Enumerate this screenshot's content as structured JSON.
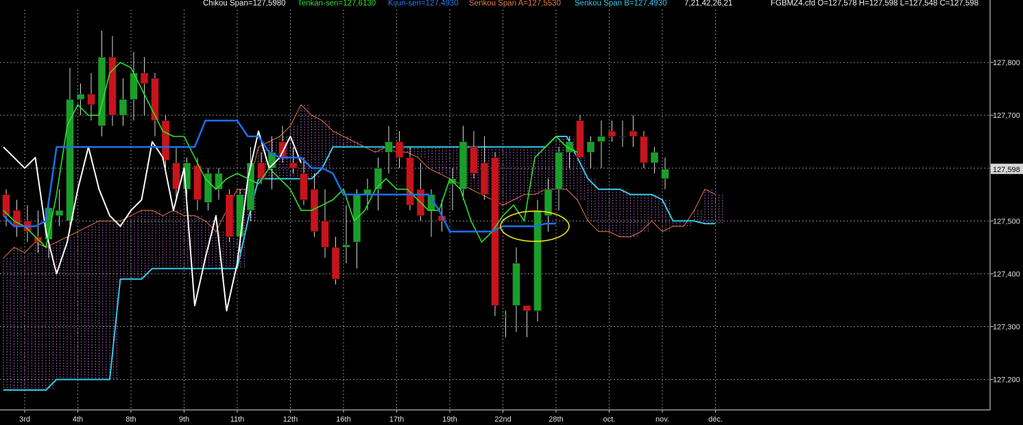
{
  "header": {
    "chikou": "Chikou Span=127,5980",
    "tenkan": "Tenkan-sen=127,6130",
    "kijun": "Kijun-sen=127,4930",
    "senkou_a": "Senkou Span A=127,5530",
    "senkou_b": "Senkou Span B=127,4930",
    "params": "7,21,42,26,21",
    "ohlc": "FGBMZ4.cfd O=127,578 H=127,598 L=127,548 C=127,598"
  },
  "colors": {
    "background": "#000000",
    "grid": "#8a8a8a",
    "bull_candle": "#1a9e2a",
    "bear_candle": "#c8141c",
    "chikou": "#ffffff",
    "tenkan": "#2ee02e",
    "kijun": "#1e6ee8",
    "senkou_a": "#e8784a",
    "senkou_b": "#35c8ea",
    "cloud_hatch": "#c070d8",
    "annotation": "#f0e020",
    "price_label_bg": "#d8d8d8"
  },
  "chart_data": {
    "type": "candlestick-ichimoku",
    "y_ticks": [
      "127,800",
      "127,700",
      "127,600",
      "127,500",
      "127,400",
      "127,300",
      "127,200"
    ],
    "y_tick_values": [
      127.8,
      127.7,
      127.6,
      127.5,
      127.4,
      127.3,
      127.2
    ],
    "ylim": [
      127.145,
      127.9
    ],
    "current_price_label": "127,598",
    "current_price": 127.598,
    "x_labels": [
      "3rd",
      "4th",
      "8th",
      "9th",
      "11th",
      "12th",
      "16th",
      "17th",
      "19th",
      "22nd",
      "28th",
      "oct.",
      "nov.",
      "déc."
    ],
    "x_label_bars": [
      2,
      7,
      12,
      17,
      22,
      27,
      32,
      37,
      42,
      47,
      52,
      57,
      62,
      67
    ],
    "bars_total": 69,
    "candles": [
      {
        "o": 127.55,
        "h": 127.56,
        "l": 127.49,
        "c": 127.51
      },
      {
        "o": 127.52,
        "h": 127.54,
        "l": 127.47,
        "c": 127.49
      },
      {
        "o": 127.5,
        "h": 127.53,
        "l": 127.46,
        "c": 127.48
      },
      {
        "o": 127.47,
        "h": 127.52,
        "l": 127.44,
        "c": 127.46
      },
      {
        "o": 127.465,
        "h": 127.54,
        "l": 127.43,
        "c": 127.525
      },
      {
        "o": 127.51,
        "h": 127.56,
        "l": 127.49,
        "c": 127.52
      },
      {
        "o": 127.5,
        "h": 127.79,
        "l": 127.48,
        "c": 127.73
      },
      {
        "o": 127.73,
        "h": 127.76,
        "l": 127.7,
        "c": 127.74
      },
      {
        "o": 127.74,
        "h": 127.78,
        "l": 127.69,
        "c": 127.72
      },
      {
        "o": 127.68,
        "h": 127.86,
        "l": 127.66,
        "c": 127.81
      },
      {
        "o": 127.81,
        "h": 127.85,
        "l": 127.68,
        "c": 127.7
      },
      {
        "o": 127.7,
        "h": 127.77,
        "l": 127.68,
        "c": 127.73
      },
      {
        "o": 127.73,
        "h": 127.82,
        "l": 127.69,
        "c": 127.78
      },
      {
        "o": 127.78,
        "h": 127.81,
        "l": 127.7,
        "c": 127.76
      },
      {
        "o": 127.77,
        "h": 127.78,
        "l": 127.66,
        "c": 127.69
      },
      {
        "o": 127.69,
        "h": 127.7,
        "l": 127.6,
        "c": 127.615
      },
      {
        "o": 127.61,
        "h": 127.64,
        "l": 127.54,
        "c": 127.56
      },
      {
        "o": 127.56,
        "h": 127.62,
        "l": 127.52,
        "c": 127.61
      },
      {
        "o": 127.605,
        "h": 127.62,
        "l": 127.52,
        "c": 127.54
      },
      {
        "o": 127.535,
        "h": 127.6,
        "l": 127.52,
        "c": 127.59
      },
      {
        "o": 127.56,
        "h": 127.6,
        "l": 127.54,
        "c": 127.59
      },
      {
        "o": 127.55,
        "h": 127.56,
        "l": 127.46,
        "c": 127.47
      },
      {
        "o": 127.47,
        "h": 127.56,
        "l": 127.44,
        "c": 127.55
      },
      {
        "o": 127.52,
        "h": 127.64,
        "l": 127.5,
        "c": 127.61
      },
      {
        "o": 127.61,
        "h": 127.63,
        "l": 127.57,
        "c": 127.58
      },
      {
        "o": 127.6,
        "h": 127.66,
        "l": 127.56,
        "c": 127.63
      },
      {
        "o": 127.65,
        "h": 127.68,
        "l": 127.61,
        "c": 127.62
      },
      {
        "o": 127.61,
        "h": 127.64,
        "l": 127.59,
        "c": 127.6
      },
      {
        "o": 127.59,
        "h": 127.62,
        "l": 127.53,
        "c": 127.54
      },
      {
        "o": 127.56,
        "h": 127.59,
        "l": 127.47,
        "c": 127.48
      },
      {
        "o": 127.5,
        "h": 127.56,
        "l": 127.43,
        "c": 127.45
      },
      {
        "o": 127.45,
        "h": 127.47,
        "l": 127.38,
        "c": 127.39
      },
      {
        "o": 127.45,
        "h": 127.53,
        "l": 127.42,
        "c": 127.455
      },
      {
        "o": 127.46,
        "h": 127.56,
        "l": 127.41,
        "c": 127.55
      },
      {
        "o": 127.55,
        "h": 127.58,
        "l": 127.52,
        "c": 127.56
      },
      {
        "o": 127.56,
        "h": 127.62,
        "l": 127.52,
        "c": 127.6
      },
      {
        "o": 127.63,
        "h": 127.68,
        "l": 127.59,
        "c": 127.65
      },
      {
        "o": 127.65,
        "h": 127.67,
        "l": 127.6,
        "c": 127.62
      },
      {
        "o": 127.62,
        "h": 127.64,
        "l": 127.52,
        "c": 127.53
      },
      {
        "o": 127.56,
        "h": 127.61,
        "l": 127.5,
        "c": 127.51
      },
      {
        "o": 127.52,
        "h": 127.56,
        "l": 127.47,
        "c": 127.55
      },
      {
        "o": 127.51,
        "h": 127.54,
        "l": 127.48,
        "c": 127.5
      },
      {
        "o": 127.57,
        "h": 127.6,
        "l": 127.52,
        "c": 127.58
      },
      {
        "o": 127.56,
        "h": 127.68,
        "l": 127.54,
        "c": 127.65
      },
      {
        "o": 127.64,
        "h": 127.67,
        "l": 127.58,
        "c": 127.59
      },
      {
        "o": 127.61,
        "h": 127.66,
        "l": 127.54,
        "c": 127.55
      },
      {
        "o": 127.62,
        "h": 127.63,
        "l": 127.32,
        "c": 127.34
      },
      {
        "o": 127.32,
        "h": 127.33,
        "l": 127.28,
        "c": 127.32
      },
      {
        "o": 127.34,
        "h": 127.45,
        "l": 127.29,
        "c": 127.42
      },
      {
        "o": 127.34,
        "h": 127.34,
        "l": 127.28,
        "c": 127.33
      },
      {
        "o": 127.33,
        "h": 127.54,
        "l": 127.31,
        "c": 127.52
      },
      {
        "o": 127.51,
        "h": 127.58,
        "l": 127.48,
        "c": 127.56
      },
      {
        "o": 127.56,
        "h": 127.64,
        "l": 127.52,
        "c": 127.63
      },
      {
        "o": 127.63,
        "h": 127.66,
        "l": 127.6,
        "c": 127.65
      },
      {
        "o": 127.69,
        "h": 127.7,
        "l": 127.62,
        "c": 127.62
      },
      {
        "o": 127.63,
        "h": 127.66,
        "l": 127.6,
        "c": 127.65
      },
      {
        "o": 127.65,
        "h": 127.69,
        "l": 127.6,
        "c": 127.66
      },
      {
        "o": 127.67,
        "h": 127.69,
        "l": 127.65,
        "c": 127.66
      },
      {
        "o": 127.66,
        "h": 127.69,
        "l": 127.64,
        "c": 127.66
      },
      {
        "o": 127.67,
        "h": 127.7,
        "l": 127.64,
        "c": 127.66
      },
      {
        "o": 127.66,
        "h": 127.67,
        "l": 127.6,
        "c": 127.61
      },
      {
        "o": 127.61,
        "h": 127.64,
        "l": 127.59,
        "c": 127.63
      },
      {
        "o": 127.58,
        "h": 127.62,
        "l": 127.56,
        "c": 127.598
      }
    ],
    "candle_start_bar": 0,
    "candle_bar_offset": [
      0,
      1,
      2,
      3,
      4,
      5,
      6,
      7,
      8,
      9,
      10,
      11,
      12,
      13,
      14,
      15,
      16,
      17,
      18,
      19,
      20,
      21,
      22,
      23,
      24,
      25,
      26,
      27,
      28,
      29,
      30,
      31,
      32,
      33,
      34,
      35,
      36,
      37,
      38,
      39,
      40,
      41,
      42,
      43,
      44,
      45,
      46,
      47,
      48,
      49,
      50
    ],
    "tenkan": [
      127.52,
      127.5,
      127.49,
      127.47,
      127.45,
      127.55,
      127.68,
      127.72,
      127.7,
      127.7,
      127.78,
      127.8,
      127.79,
      127.75,
      127.71,
      127.67,
      127.66,
      127.66,
      127.62,
      127.58,
      127.56,
      127.58,
      127.59,
      127.58,
      127.57,
      127.6,
      127.58,
      127.56,
      127.52,
      127.52,
      127.53,
      127.54,
      127.56,
      127.5,
      127.52,
      127.56,
      127.58,
      127.56,
      127.56,
      127.54,
      127.52,
      127.52,
      127.58,
      127.56,
      127.5,
      127.46,
      127.48,
      127.51,
      127.53,
      127.5,
      127.62,
      127.64,
      127.66,
      127.64,
      127.63
    ],
    "kijun": [
      127.51,
      127.49,
      127.49,
      127.49,
      127.5,
      127.64,
      127.64,
      127.64,
      127.64,
      127.64,
      127.64,
      127.64,
      127.64,
      127.64,
      127.64,
      127.64,
      127.64,
      127.64,
      127.64,
      127.69,
      127.69,
      127.69,
      127.69,
      127.66,
      127.66,
      127.63,
      127.62,
      127.62,
      127.62,
      127.6,
      127.6,
      127.59,
      127.55,
      127.55,
      127.55,
      127.55,
      127.55,
      127.55,
      127.55,
      127.55,
      127.55,
      127.52,
      127.48,
      127.48,
      127.48,
      127.48,
      127.48,
      127.49,
      127.49,
      127.49,
      127.49,
      127.495,
      127.495
    ],
    "chikou": [
      127.64,
      127.62,
      127.6,
      127.62,
      127.48,
      127.4,
      127.46,
      127.56,
      127.64,
      127.56,
      127.51,
      127.49,
      127.52,
      127.54,
      127.65,
      127.62,
      127.52,
      127.6,
      127.34,
      127.43,
      127.51,
      127.33,
      127.42,
      127.58,
      127.67,
      127.6,
      127.62,
      127.66,
      127.61
    ],
    "senkou_a": [
      127.43,
      127.45,
      127.44,
      127.46,
      127.45,
      127.46,
      127.47,
      127.48,
      127.49,
      127.5,
      127.5,
      127.5,
      127.51,
      127.52,
      127.52,
      127.51,
      127.52,
      127.51,
      127.51,
      127.5,
      127.48,
      127.52,
      127.56,
      127.56,
      127.64,
      127.65,
      127.66,
      127.68,
      127.72,
      127.7,
      127.69,
      127.67,
      127.66,
      127.65,
      127.64,
      127.63,
      127.64,
      127.63,
      127.63,
      127.62,
      127.6,
      127.59,
      127.58,
      127.57,
      127.56,
      127.55,
      127.54,
      127.53,
      127.54,
      127.55,
      127.55,
      127.56,
      127.56,
      127.56,
      127.54,
      127.5,
      127.48,
      127.48,
      127.47,
      127.47,
      127.48,
      127.5,
      127.48,
      127.49,
      127.49,
      127.52,
      127.56,
      127.55
    ],
    "senkou_b": [
      127.18,
      127.18,
      127.18,
      127.18,
      127.18,
      127.2,
      127.2,
      127.2,
      127.2,
      127.2,
      127.2,
      127.39,
      127.39,
      127.39,
      127.41,
      127.41,
      127.41,
      127.41,
      127.41,
      127.41,
      127.41,
      127.41,
      127.41,
      127.5,
      127.58,
      127.58,
      127.58,
      127.58,
      127.58,
      127.58,
      127.6,
      127.64,
      127.64,
      127.64,
      127.64,
      127.64,
      127.64,
      127.64,
      127.64,
      127.64,
      127.64,
      127.64,
      127.64,
      127.64,
      127.64,
      127.64,
      127.64,
      127.64,
      127.64,
      127.64,
      127.64,
      127.64,
      127.66,
      127.66,
      127.62,
      127.58,
      127.56,
      127.56,
      127.56,
      127.55,
      127.55,
      127.55,
      127.54,
      127.5,
      127.5,
      127.5,
      127.495,
      127.495
    ]
  }
}
